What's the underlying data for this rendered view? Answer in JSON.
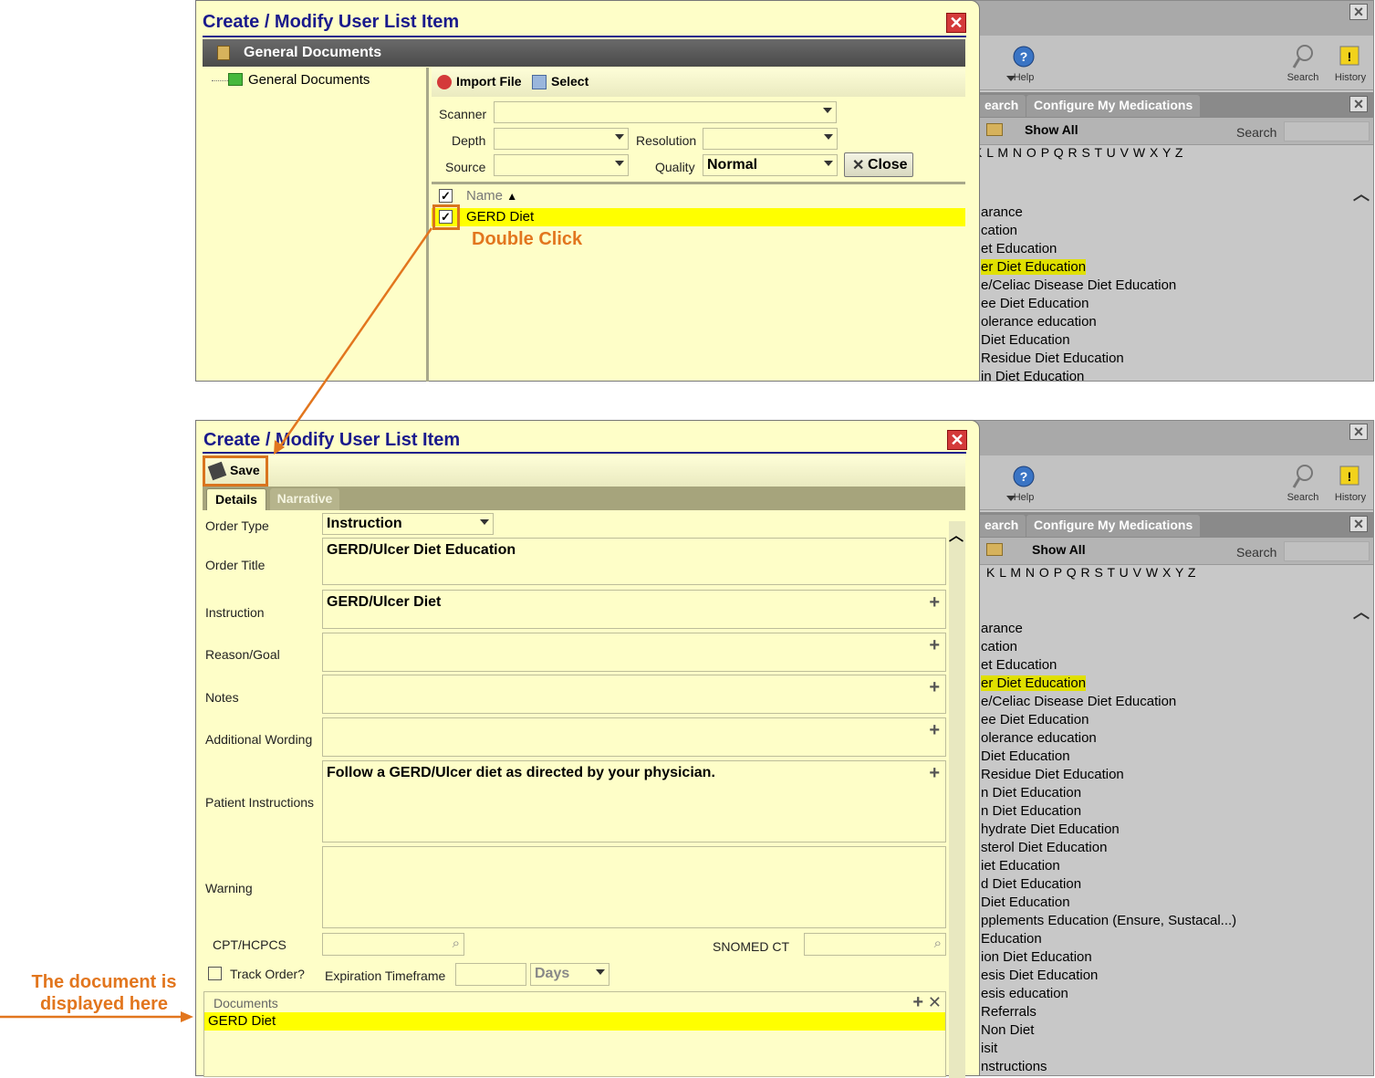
{
  "top": {
    "title": "Create / Modify User List Item",
    "section_header": "General Documents",
    "tree_item": "General Documents",
    "toolbar": {
      "import_file": "Import File",
      "select": "Select"
    },
    "scanner_label": "Scanner",
    "depth_label": "Depth",
    "resolution_label": "Resolution",
    "source_label": "Source",
    "quality_label": "Quality",
    "quality_value": "Normal",
    "close_label": "Close",
    "name_header": "Name",
    "row_name": "GERD Diet",
    "callout": "Double Click"
  },
  "background": {
    "help_label": "Help",
    "search_label": "Search",
    "history_label": "History",
    "tab_search": "earch",
    "tab_configure": "Configure My Medications",
    "show_all": "Show All",
    "search_field_label": "Search",
    "alphabet": "K L M N O P Q R S T U V W X Y Z",
    "list_top": [
      "arance",
      "cation",
      "et Education",
      "er Diet Education",
      "e/Celiac Disease Diet Education",
      "ee Diet Education",
      "olerance education",
      "Diet Education",
      "Residue Diet Education",
      "in Diet Education"
    ],
    "list_bottom": [
      "arance",
      "cation",
      "et Education",
      "er Diet Education",
      "e/Celiac Disease Diet Education",
      "ee Diet Education",
      "olerance education",
      "Diet Education",
      "Residue Diet Education",
      "n Diet Education",
      "n Diet Education",
      "hydrate Diet Education",
      "sterol Diet Education",
      "iet Education",
      "d Diet Education",
      "Diet Education",
      "pplements Education (Ensure, Sustacal...)",
      "Education",
      "ion Diet Education",
      "esis Diet Education",
      "esis education",
      "Referrals",
      "Non Diet",
      "isit",
      "nstructions"
    ],
    "highlight_index": 3
  },
  "bottom": {
    "title": "Create / Modify User List Item",
    "save_label": "Save",
    "tabs": [
      "Details",
      "Narrative"
    ],
    "order_type_label": "Order Type",
    "order_type_value": "Instruction",
    "order_title_label": "Order Title",
    "order_title_value": "GERD/Ulcer Diet Education",
    "instruction_label": "Instruction",
    "instruction_value": "GERD/Ulcer Diet",
    "reason_label": "Reason/Goal",
    "notes_label": "Notes",
    "additional_label": "Additional Wording",
    "patient_label": "Patient Instructions",
    "patient_value": "Follow a GERD/Ulcer diet as directed by your physician.",
    "warning_label": "Warning",
    "cpt_label": "CPT/HCPCS",
    "snomed_label": "SNOMED CT",
    "track_label": "Track Order?",
    "expiration_label": "Expiration Timeframe",
    "days_value": "Days",
    "documents_label": "Documents",
    "document_row": "GERD Diet"
  },
  "annotation": {
    "line1": "The document is",
    "line2": "displayed here"
  },
  "colors": {
    "highlight": "#ffff00",
    "callout": "#e2761e",
    "title": "#1a1a8c"
  }
}
